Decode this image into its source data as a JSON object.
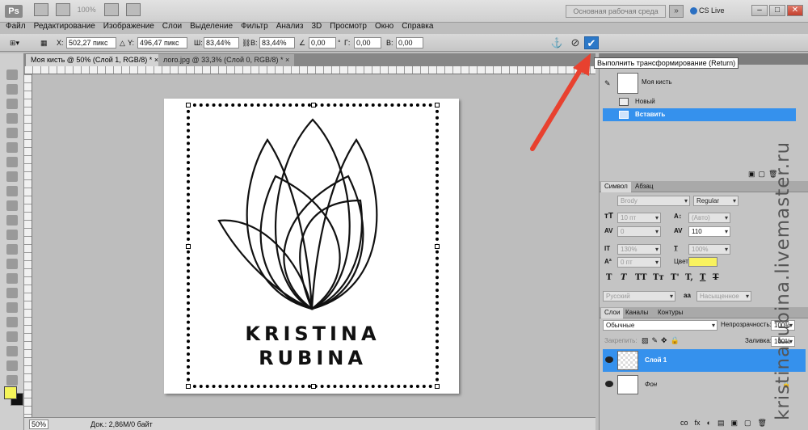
{
  "app": {
    "logo": "Ps",
    "zoom_display": "100%",
    "workspace": "Основная рабочая среда",
    "workspace_more": "»",
    "cs_live": "CS Live",
    "window_buttons": [
      "–",
      "□",
      "✕"
    ]
  },
  "menu": [
    "Файл",
    "Редактирование",
    "Изображение",
    "Слои",
    "Выделение",
    "Фильтр",
    "Анализ",
    "3D",
    "Просмотр",
    "Окно",
    "Справка"
  ],
  "options": {
    "x_label": "X:",
    "x_value": "502,27 пикс",
    "y_label": "Y:",
    "y_value": "496,47 пикс",
    "w_label": "Ш:",
    "w_value": "83,44%",
    "h_label": "В:",
    "h_value": "83,44%",
    "angle_value": "0,00",
    "angle_unit": "°",
    "h_skew_label": "Г:",
    "h_skew_value": "0,00",
    "v_skew_label": "В:",
    "v_skew_value": "0,00",
    "cancel_icon": "⊘",
    "commit_icon": "✔"
  },
  "tabs": [
    {
      "label": "Моя кисть @ 50% (Слой 1, RGB/8) *",
      "close": "×"
    },
    {
      "label": "лого.jpg @ 33,3% (Слой 0, RGB/8) *",
      "close": "×"
    }
  ],
  "tooltip": "Выполнить трансформирование (Return)",
  "canvas": {
    "line1": "KRISTINA",
    "line2": "RUBINA"
  },
  "status": {
    "zoom": "50%",
    "doc": "Док.: 2,86M/0 байт"
  },
  "history": {
    "snapshot": "Моя кисть",
    "items": [
      "Новый",
      "Вставить"
    ]
  },
  "character": {
    "tabs": [
      "Символ",
      "Абзац"
    ],
    "font": "Brody",
    "style": "Regular",
    "size": "10 пт",
    "leading": "(Авто)",
    "kerning": "0",
    "tracking": "110",
    "vscale": "130%",
    "hscale": "100%",
    "baseline": "0 пт",
    "color_label": "Цвет:",
    "style_buttons": [
      "T",
      "T",
      "TT",
      "Tт",
      "T'",
      "T,",
      "T",
      "T"
    ],
    "language": "Русский",
    "aa_icon": "aa",
    "antialias": "Насыщенное"
  },
  "layers": {
    "tabs": [
      "Слои",
      "Каналы",
      "Контуры"
    ],
    "blend": "Обычные",
    "opacity_label": "Непрозрачность:",
    "opacity": "100%",
    "lock_label": "Закрепить:",
    "fill_label": "Заливка:",
    "fill": "100%",
    "items": [
      {
        "name": "Слой 1",
        "selected": true
      },
      {
        "name": "Фон",
        "selected": false
      }
    ],
    "footer_icons": [
      "co",
      "fx",
      "◐",
      "▤",
      "▣",
      "▢",
      "🗑"
    ]
  },
  "watermark": "kristinarubina.livemaster.ru",
  "colors": {
    "selection_blue": "#3591ed",
    "foreground": "#f5f55a",
    "arrow_red": "#e8412f"
  }
}
